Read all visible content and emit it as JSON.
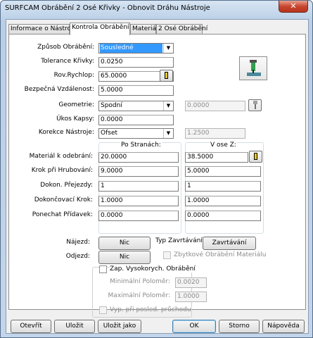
{
  "window": {
    "title": "SURFCAM Obrábění 2 Osé Křivky - Obnovit Dráhu Nástroje",
    "close": "✕"
  },
  "tabs": [
    "Informace o Nástroji",
    "Kontrola Obrábění",
    "Materiál",
    "2 Osé Obrábění"
  ],
  "form": {
    "zpusob_label": "Způsob Obrábění:",
    "zpusob_value": "Sousledné",
    "tolerance_label": "Tolerance Křivky:",
    "tolerance_value": "0.0250",
    "rychlop_label": "Rov.Rychlop:",
    "rychlop_value": "65.0000",
    "bezpecna_label": "Bezpečná Vzdálenost:",
    "bezpecna_value": "5.0000",
    "geometrie_label": "Geometrie:",
    "geometrie_value": "Spodní",
    "geometrie_disabled_value": "0.0000",
    "ukos_label": "Úkos Kapsy:",
    "ukos_value": "0.0000",
    "korekce_label": "Korekce Nástroje:",
    "korekce_value": "Ofset",
    "korekce_disabled_value": "1.2500",
    "col_strany": "Po Stranách:",
    "col_osez": "V ose Z:",
    "rows": [
      {
        "label": "Materiál k odebrání:",
        "a": "20.0000",
        "b": "38.5000"
      },
      {
        "label": "Krok při Hrubování:",
        "a": "9.0000",
        "b": "5.0000"
      },
      {
        "label": "Dokon. Přejezdy:",
        "a": "1",
        "b": "1"
      },
      {
        "label": "Dokončovací Krok:",
        "a": "1.0000",
        "b": "1.0000"
      },
      {
        "label": "Ponechat Přídavek:",
        "a": "0.0000",
        "b": "0.0000"
      }
    ],
    "najezd_label": "Nájezd:",
    "najezd_btn": "Nic",
    "odjezd_label": "Odjezd:",
    "odjezd_btn": "Nic",
    "typ_label": "Typ Zavrtávání:",
    "typ_btn": "Zavrtávání",
    "zbytkove_label": "Zbytkové Obrábění Materiálu",
    "vysoko_label": "Zap. Vysokorych. Obrábění",
    "min_label": "Minimální Poloměr:",
    "min_value": "0.0020",
    "max_label": "Maximální Poloměr:",
    "max_value": "1.0000",
    "posled_label": "Vyp. při posled. průchodu"
  },
  "buttons": [
    "Otevřít",
    "Uložit",
    "Uložit jako",
    "OK",
    "Storno",
    "Nápověda"
  ],
  "colors": {
    "accent": "#3399ff",
    "titlebar": "#c3d5ea",
    "close": "#c7462f"
  }
}
